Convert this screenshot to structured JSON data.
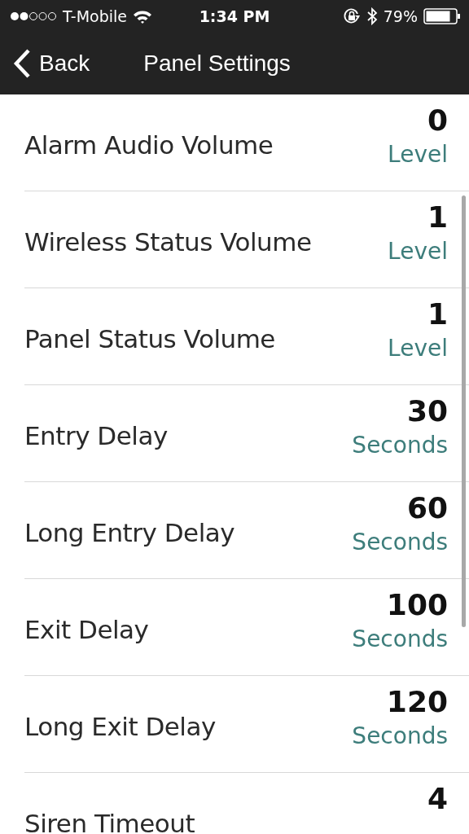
{
  "status_bar": {
    "carrier": "T-Mobile",
    "time": "1:34 PM",
    "battery_percent": "79%"
  },
  "nav": {
    "back": "Back",
    "title": "Panel Settings"
  },
  "settings": [
    {
      "label": "Alarm Audio Volume",
      "value": "0",
      "unit": "Level"
    },
    {
      "label": "Wireless Status Volume",
      "value": "1",
      "unit": "Level"
    },
    {
      "label": "Panel Status Volume",
      "value": "1",
      "unit": "Level"
    },
    {
      "label": "Entry Delay",
      "value": "30",
      "unit": "Seconds"
    },
    {
      "label": "Long Entry Delay",
      "value": "60",
      "unit": "Seconds"
    },
    {
      "label": "Exit Delay",
      "value": "100",
      "unit": "Seconds"
    },
    {
      "label": "Long Exit Delay",
      "value": "120",
      "unit": "Seconds"
    },
    {
      "label": "Siren Timeout",
      "value": "4"
    }
  ]
}
